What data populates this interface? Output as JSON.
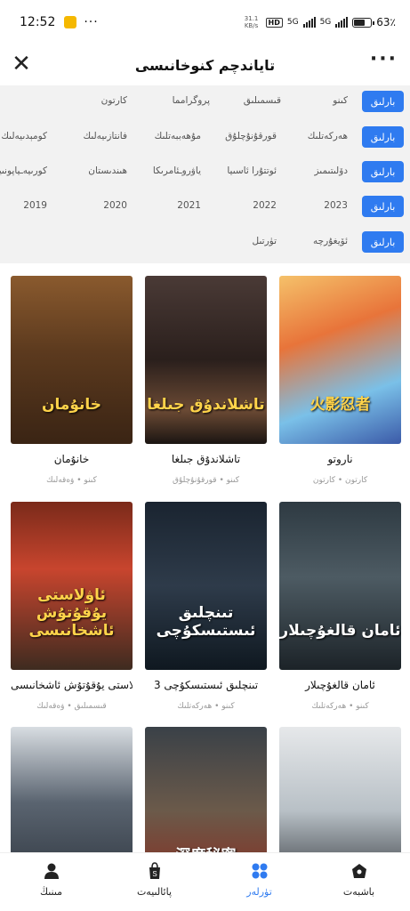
{
  "status_bar": {
    "time": "12:52",
    "overflow": "···",
    "net_speed": "31.1 KB/s",
    "hd": "HD",
    "sim1": "5G",
    "sim2": "5G",
    "battery_text": "63٪",
    "battery_level": 0.63
  },
  "header": {
    "title": "تاياندچم كنوخانىسى",
    "close_icon": "close-icon",
    "more_icon": "more-icon"
  },
  "filters": {
    "all_label": "بارلىق",
    "rows": [
      {
        "options": [
          "كىنو",
          "قىسمىلىق",
          "پروگرامما",
          "كارتون"
        ]
      },
      {
        "options": [
          "ھەركەتلىك",
          "قورقۇنۇچلۇق",
          "مۇھەببەتلىك",
          "فانتازىيەلىك",
          "كومېدىيەلىك"
        ]
      },
      {
        "options": [
          "دۆلىتىمىز",
          "ئوتتۇرا ئاسىيا",
          "ياۋروـئامرىكا",
          "ھىندىستان",
          "كورىيەـياپونىيە"
        ]
      },
      {
        "options": [
          "2023",
          "2022",
          "2021",
          "2020",
          "2019"
        ]
      },
      {
        "options": [
          "ئۆيغۇرچە",
          "تۈرتىل"
        ]
      }
    ]
  },
  "movies": [
    {
      "title": "ناروتو",
      "meta": "كارتون • كارتون",
      "poster_text": "火影忍者"
    },
    {
      "title": "تاشلاندۇق جىلغا",
      "meta": "كىنو • قورقۇنۇچلۇق",
      "poster_text": "تاشلاندۇق جىلغا"
    },
    {
      "title": "خانۇمان",
      "meta": "كىنو • ۋەقەلىك",
      "poster_text": "خانۇمان"
    },
    {
      "title": "ئامان قالغۇچىلار",
      "meta": "كىنو • ھەركەتلىك",
      "poster_text": "ئامان قالغۇچىلار"
    },
    {
      "title": "تىنچلىق ئىستىسكۇچى 3",
      "meta": "كىنو • ھەركەتلىك",
      "poster_text": "تىنچلىق ئىستىسكۇچى"
    },
    {
      "title": "ئاۋلاستى يۇقۇتۇش ئاشخانىسى",
      "meta": "قىسمىلىق • ۋەقەلىك",
      "poster_text": "ئاۋلاستى يۇقۇتۇش ئاشخانىسى"
    },
    {
      "title": "",
      "meta": "",
      "poster_text": ""
    },
    {
      "title": "",
      "meta": "",
      "poster_text": "深度秘密"
    },
    {
      "title": "",
      "meta": "",
      "poster_text": ""
    }
  ],
  "bottom_nav": [
    {
      "label": "باشبەت",
      "icon": "home-icon",
      "active": false
    },
    {
      "label": "تۈرلەر",
      "icon": "categories-icon",
      "active": true
    },
    {
      "label": "پائالىيەت",
      "icon": "shop-icon",
      "active": false
    },
    {
      "label": "مىنىڭ",
      "icon": "profile-icon",
      "active": false
    }
  ],
  "colors": {
    "accent": "#2f7bf0",
    "filter_bg": "#f2f2f2",
    "meta_text": "#999999"
  }
}
